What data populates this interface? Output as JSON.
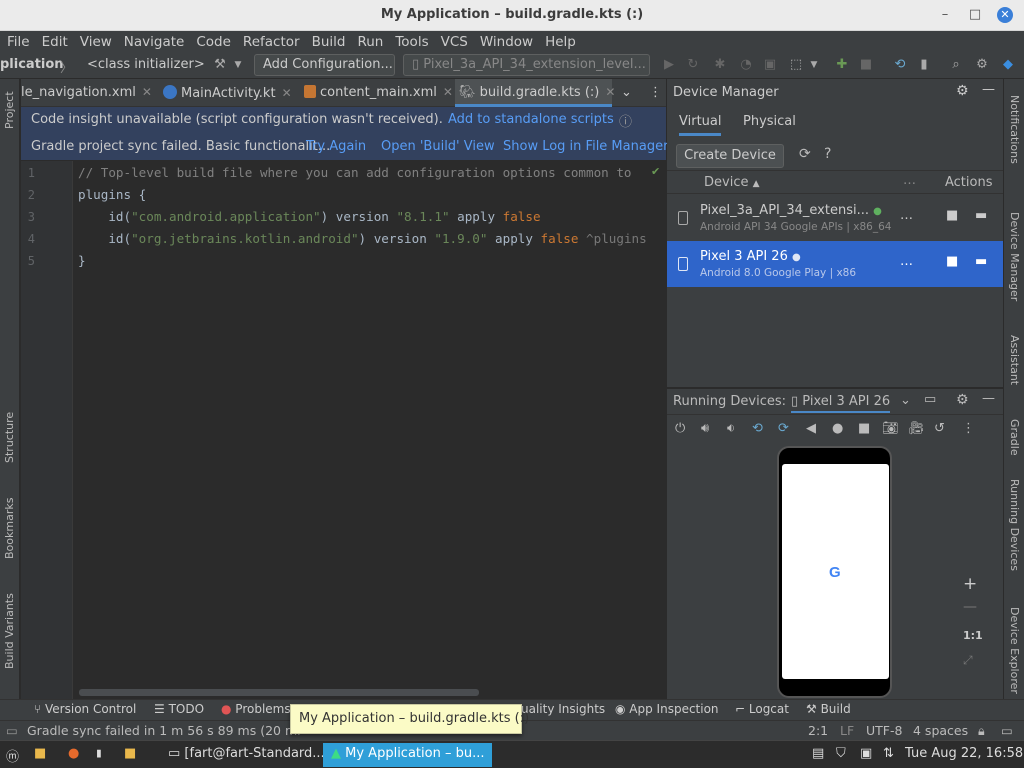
{
  "window": {
    "title": "My Application – build.gradle.kts (:)"
  },
  "menu": [
    "File",
    "Edit",
    "View",
    "Navigate",
    "Code",
    "Refactor",
    "Build",
    "Run",
    "Tools",
    "VCS",
    "Window",
    "Help"
  ],
  "toolbar": {
    "project": "plication",
    "breadcrumb": "<class initializer>",
    "add_config": "Add Configuration...",
    "device_select": "Pixel_3a_API_34_extension_level..."
  },
  "editor_tabs": [
    {
      "label": "le_navigation.xml"
    },
    {
      "label": "MainActivity.kt"
    },
    {
      "label": "content_main.xml"
    },
    {
      "label": "build.gradle.kts (:)"
    }
  ],
  "notice": {
    "line1": "Code insight unavailable (script configuration wasn't received).",
    "line1_link": "Add to standalone scripts",
    "line2": "Gradle project sync failed. Basic functionalit...",
    "try_again": "Try Again",
    "open_build": "Open 'Build' View",
    "show_log": "Show Log in File Manager"
  },
  "code": {
    "line_numbers": [
      "1",
      "2",
      "3",
      "4",
      "5"
    ],
    "l1": "// Top-level build file where you can add configuration options common to",
    "l2": "plugins {",
    "l3a": "    id(",
    "l3b": "\"com.android.application\"",
    "l3c": ") version ",
    "l3d": "\"8.1.1\"",
    "l3e": " apply ",
    "l3f": "false",
    "l4a": "    id(",
    "l4b": "\"org.jetbrains.kotlin.android\"",
    "l4c": ") version ",
    "l4d": "\"1.9.0\"",
    "l4e": " apply ",
    "l4f": "false",
    "l4g": " ^plugins",
    "l5": "}"
  },
  "device_manager": {
    "title": "Device Manager",
    "tab_virtual": "Virtual",
    "tab_physical": "Physical",
    "create": "Create Device",
    "col_device": "Device",
    "col_actions": "Actions",
    "devices": [
      {
        "name": "Pixel_3a_API_34_extensi...",
        "sub": "Android API 34 Google APIs | x86_64"
      },
      {
        "name": "Pixel 3 API 26",
        "sub": "Android 8.0 Google Play | x86"
      }
    ]
  },
  "running_devices": {
    "label": "Running Devices:",
    "device": "Pixel 3 API 26",
    "zoom_label": "1:1"
  },
  "left_tools": {
    "project": "Project",
    "structure": "Structure",
    "bookmarks": "Bookmarks",
    "build_variants": "Build Variants"
  },
  "right_tools": {
    "notifications": "Notifications",
    "device_manager": "Device Manager",
    "assistant": "Assistant",
    "gradle": "Gradle",
    "running_devices": "Running Devices",
    "device_explorer": "Device Explorer"
  },
  "bottom_tools": {
    "vcs": "Version Control",
    "todo": "TODO",
    "problems": "Problems",
    "insights": "uality Insights",
    "inspection": "App Inspection",
    "logcat": "Logcat",
    "build": "Build"
  },
  "status": {
    "message": "Gradle sync failed in 1 m 56 s 89 ms (20 mi",
    "position": "2:1",
    "lf": "LF",
    "encoding": "UTF-8",
    "indent": "4 spaces"
  },
  "tooltip": "My Application – build.gradle.kts (:)",
  "taskbar": {
    "terminal": "[fart@fart-Standard...",
    "app": "My Application – bu...",
    "clock": "Tue Aug 22, 16:58"
  }
}
